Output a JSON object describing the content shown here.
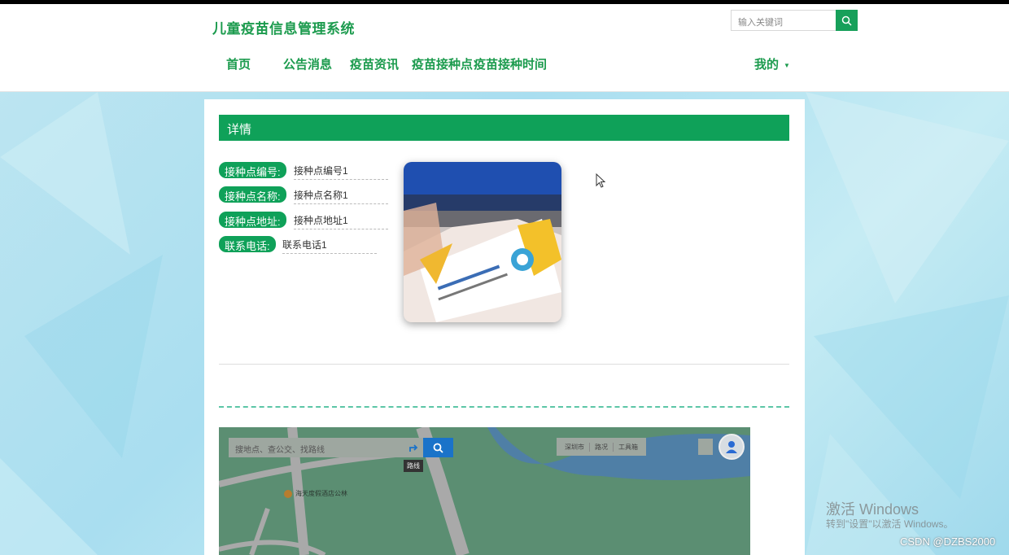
{
  "header": {
    "site_title": "儿童疫苗信息管理系统",
    "search_placeholder": "输入关键词"
  },
  "nav": {
    "items": [
      "首页",
      "公告消息",
      "疫苗资讯",
      "疫苗接种点",
      "疫苗接种时间"
    ],
    "user_menu": "我的"
  },
  "detail": {
    "section_title": "详情",
    "fields": [
      {
        "label": "接种点编号:",
        "value": "接种点编号1"
      },
      {
        "label": "接种点名称:",
        "value": "接种点名称1"
      },
      {
        "label": "接种点地址:",
        "value": "接种点地址1"
      },
      {
        "label": "联系电话:",
        "value": "联系电话1"
      }
    ]
  },
  "map": {
    "search_placeholder": "搜地点、查公交、找路线",
    "route_tip": "路线",
    "tools": [
      "深圳市",
      "路况",
      "工具箱"
    ],
    "poi": "海天度假酒店公林"
  },
  "overlay": {
    "activate_title": "激活 Windows",
    "activate_sub": "转到\"设置\"以激活 Windows。",
    "csdn": "CSDN @DZBS2000"
  },
  "colors": {
    "accent": "#0fa159",
    "nav_text": "#1c9b4e"
  }
}
